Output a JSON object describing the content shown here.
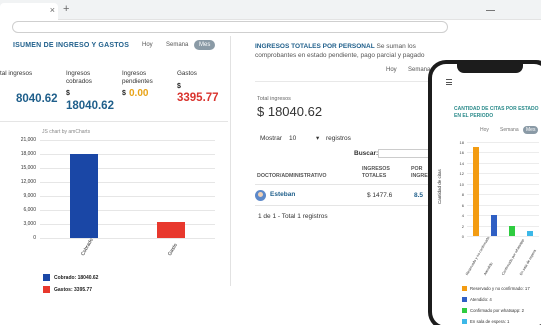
{
  "browser": {
    "tab_close": "×",
    "new_tab": "+"
  },
  "income_summary": {
    "title": "ISUMEN DE INGRESO Y GASTOS",
    "periods": [
      "Hoy",
      "Semana",
      "Mes"
    ],
    "active_period": "Mes",
    "stats": [
      {
        "label": "tal ingresos",
        "prefix": "",
        "value": "8040.62",
        "color": "#1f5f8b"
      },
      {
        "label": "Ingresos\ncobrados",
        "prefix": "$",
        "value": "18040.62",
        "color": "#1f5f8b"
      },
      {
        "label": "Ingresos\npendientes",
        "prefix": "$",
        "value": "0.00",
        "color": "#e8a317"
      },
      {
        "label": "Gastos",
        "prefix": "$",
        "value": "3395.77",
        "color": "#d9332d"
      }
    ]
  },
  "chart_data": [
    {
      "type": "bar",
      "categories": [
        "Cobrado",
        "Gasto"
      ],
      "values": [
        18040.62,
        3395.77
      ],
      "colors": [
        "#1a47a6",
        "#e8382d"
      ],
      "ylim": [
        0,
        21000
      ],
      "yticks": [
        "21,000",
        "18,000",
        "15,000",
        "12,000",
        "9,000",
        "6,000",
        "3,000",
        "0"
      ],
      "credit": "JS chart by amCharts",
      "legend": [
        {
          "label": "Cobrado: 18040.62",
          "color": "#1a47a6"
        },
        {
          "label": "Gastos: 3395.77",
          "color": "#e8382d"
        }
      ]
    },
    {
      "type": "bar",
      "title": "CANTIDAD DE CITAS POR ESTADO EN EL PERIODO",
      "ylabel": "Cantidad de citas",
      "categories": [
        "Reservado y no confirmado",
        "Atendido",
        "Confirmado por whatsapp",
        "En sala de espera"
      ],
      "values": [
        17,
        4,
        2,
        1
      ],
      "colors": [
        "#f39c12",
        "#2f5fc4",
        "#2ecc40",
        "#3cb8e8"
      ],
      "ylim": [
        0,
        18
      ],
      "yticks": [
        "18",
        "16",
        "14",
        "12",
        "10",
        "8",
        "6",
        "4",
        "2",
        "0"
      ],
      "periods": [
        "Hoy",
        "Semana",
        "Mes"
      ],
      "active_period": "Mes",
      "legend": [
        {
          "label": "Reservado y no confirmado: 17",
          "color": "#f39c12"
        },
        {
          "label": "Atendido: 4",
          "color": "#2f5fc4"
        },
        {
          "label": "Confirmado por whatsapp: 2",
          "color": "#2ecc40"
        },
        {
          "label": "En sala de espera: 1",
          "color": "#3cb8e8"
        }
      ]
    }
  ],
  "personal_income": {
    "title_bold": "INGRESOS TOTALES POR PERSONAL",
    "title_rest": " Se suman los comprobantes en estado pendiente, pago parcial y pagado",
    "periods": [
      "Hoy",
      "Semana"
    ],
    "total_label": "Total ingresos",
    "total_value": "$ 18040.62",
    "show_label": "Mostrar",
    "show_value": "10",
    "show_caret": "▾",
    "records_label": "registros",
    "search_label": "Buscar:",
    "columns": [
      "DOCTOR/ADMINISTRATIVO",
      "INGRESOS\nTOTALES",
      "POR\nINGRE"
    ],
    "rows": [
      {
        "name": "Esteban",
        "total": "$ 1477.6",
        "other": "8.5"
      }
    ],
    "footer": "1 de 1 - Total 1 registros"
  }
}
